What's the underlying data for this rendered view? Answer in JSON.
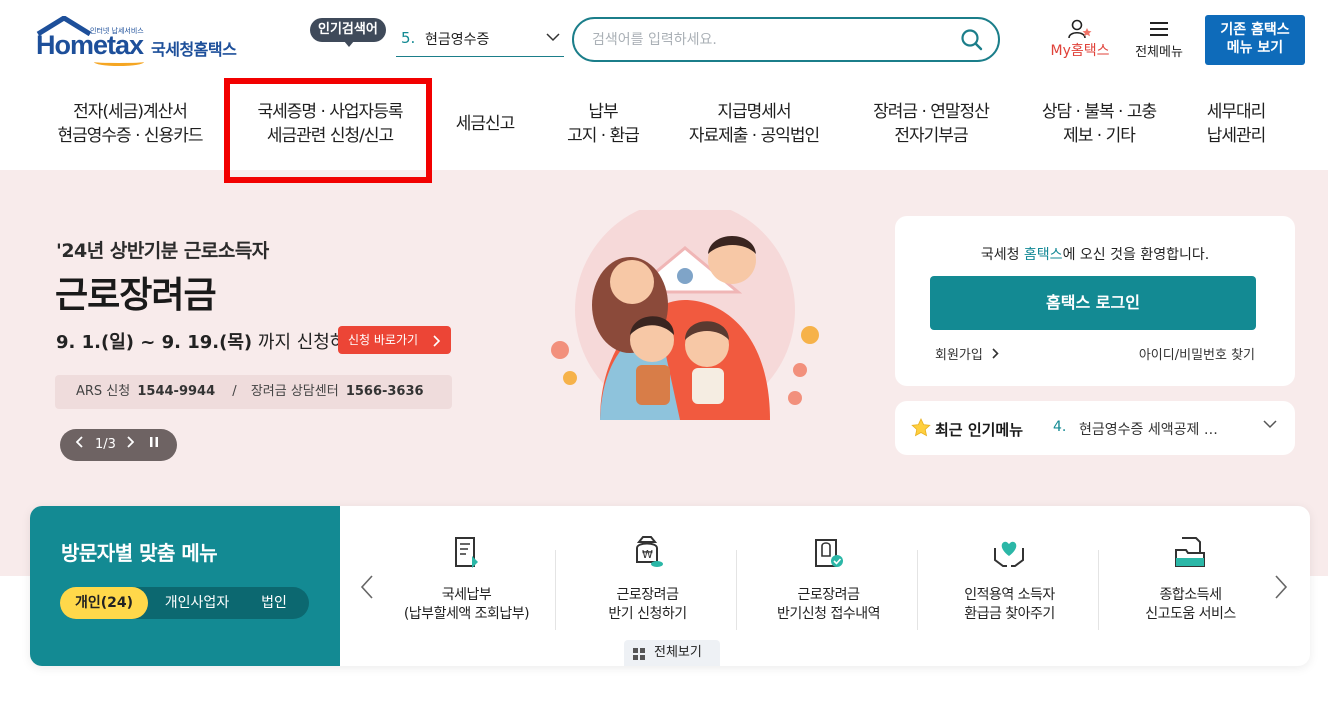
{
  "header": {
    "logo_word": "Hometax",
    "logo_tiny": "인터넷 납세서비스",
    "logo_kr": "국세청홈택스",
    "popular_badge": "인기검색어",
    "popular_num": "5.",
    "popular_text": "현금영수증",
    "search_placeholder": "검색어를 입력하세요.",
    "my_hometax": "My홈택스",
    "all_menu": "전체메뉴",
    "legacy_line1": "기존 홈택스",
    "legacy_line2": "메뉴 보기"
  },
  "gnb": [
    {
      "l1": "전자(세금)계산서",
      "l2": "현금영수증 · 신용카드"
    },
    {
      "l1": "국세증명 · 사업자등록",
      "l2": "세금관련 신청/신고"
    },
    {
      "l1": "세금신고",
      "l2": ""
    },
    {
      "l1": "납부",
      "l2": "고지 · 환급"
    },
    {
      "l1": "지급명세서",
      "l2": "자료제출 · 공익법인"
    },
    {
      "l1": "장려금 · 연말정산",
      "l2": "전자기부금"
    },
    {
      "l1": "상담 · 불복 · 고충",
      "l2": "제보 · 기타"
    },
    {
      "l1": "세무대리",
      "l2": "납세관리"
    }
  ],
  "hero": {
    "subtitle": "'24년 상반기분 근로소득자",
    "title": "근로장려금",
    "period_bold": "9. 1.(일) ~ 9. 19.(목)",
    "period_rest": " 까지 신청하세요!",
    "apply_button": "신청 바로가기",
    "ars_label": "ARS 신청",
    "ars_number": "1544-9944",
    "separator": "/",
    "center_label": "장려금 상담센터",
    "center_number": "1566-3636",
    "pager": "1/3"
  },
  "login": {
    "welcome_pre": "국세청 ",
    "welcome_hl": "홈택스",
    "welcome_post": "에 오신 것을 환영합니다.",
    "login_button": "홈택스 로그인",
    "join": "회원가입",
    "find": "아이디/비밀번호 찾기"
  },
  "popular_menu": {
    "label": "최근 인기메뉴",
    "num": "4.",
    "text": "현금영수증 세액공제 …"
  },
  "visitor_menu": {
    "title": "방문자별 맞춤 메뉴",
    "tabs": [
      "개인(24)",
      "개인사업자",
      "법인"
    ],
    "items": [
      {
        "l1": "국세납부",
        "l2": "(납부할세액 조회납부)",
        "icon": "tax-payment-icon"
      },
      {
        "l1": "근로장려금",
        "l2": "반기 신청하기",
        "icon": "money-bag-icon"
      },
      {
        "l1": "근로장려금",
        "l2": "반기신청 접수내역",
        "icon": "receipt-check-icon"
      },
      {
        "l1": "인적용역 소득자",
        "l2": "환급금 찾아주기",
        "icon": "heart-hands-icon"
      },
      {
        "l1": "종합소득세",
        "l2": "신고도움 서비스",
        "icon": "folder-doc-icon"
      }
    ],
    "view_all": "전체보기"
  },
  "colors": {
    "brand_teal": "#138a93",
    "brand_blue": "#1d4f9a",
    "accent_red": "#ec4536",
    "hero_bg": "#f8ebeb",
    "highlight_box": "#f20000"
  }
}
